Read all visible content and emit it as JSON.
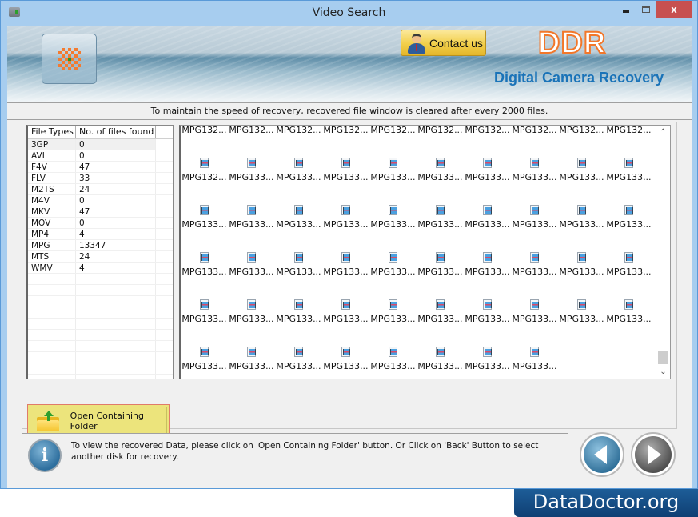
{
  "window": {
    "title": "Video Search",
    "controls": {
      "minimize": "-",
      "maximize": "□",
      "close": "x"
    }
  },
  "banner": {
    "logo_icon": "ddr-dots-logo-icon",
    "contact_button": {
      "label": "Contact us",
      "icon": "support-person-icon"
    },
    "brand_logo": "DDR",
    "product_name": "Digital Camera Recovery"
  },
  "notice": "To maintain the speed of recovery, recovered file window is cleared after every 2000 files.",
  "file_types_table": {
    "columns": [
      "File Types",
      "No. of files found"
    ],
    "rows": [
      {
        "type": "3GP",
        "count": "0"
      },
      {
        "type": "AVI",
        "count": "0"
      },
      {
        "type": "F4V",
        "count": "47"
      },
      {
        "type": "FLV",
        "count": "33"
      },
      {
        "type": "M2TS",
        "count": "24"
      },
      {
        "type": "M4V",
        "count": "0"
      },
      {
        "type": "MKV",
        "count": "47"
      },
      {
        "type": "MOV",
        "count": "0"
      },
      {
        "type": "MP4",
        "count": "4"
      },
      {
        "type": "MPG",
        "count": "13347"
      },
      {
        "type": "MTS",
        "count": "24"
      },
      {
        "type": "WMV",
        "count": "4"
      }
    ],
    "empty_rows": 10
  },
  "open_folder_button": {
    "label": "Open Containing Folder",
    "icon": "folder-up-arrow-icon"
  },
  "recovered_files": {
    "icon": "video-file-icon",
    "items": [
      "MPG132...",
      "MPG132...",
      "MPG132...",
      "MPG132...",
      "MPG132...",
      "MPG132...",
      "MPG132...",
      "MPG132...",
      "MPG132...",
      "MPG132...",
      "MPG132...",
      "MPG133...",
      "MPG133...",
      "MPG133...",
      "MPG133...",
      "MPG133...",
      "MPG133...",
      "MPG133...",
      "MPG133...",
      "MPG133...",
      "MPG133...",
      "MPG133...",
      "MPG133...",
      "MPG133...",
      "MPG133...",
      "MPG133...",
      "MPG133...",
      "MPG133...",
      "MPG133...",
      "MPG133...",
      "MPG133...",
      "MPG133...",
      "MPG133...",
      "MPG133...",
      "MPG133...",
      "MPG133...",
      "MPG133...",
      "MPG133...",
      "MPG133...",
      "MPG133...",
      "MPG133...",
      "MPG133...",
      "MPG133...",
      "MPG133...",
      "MPG133...",
      "MPG133...",
      "MPG133...",
      "MPG133...",
      "MPG133...",
      "MPG133...",
      "MPG133...",
      "MPG133...",
      "MPG133...",
      "MPG133...",
      "MPG133...",
      "MPG133...",
      "MPG133...",
      "MPG133..."
    ],
    "scroll_position_fraction": 0.95
  },
  "info": {
    "icon": "info-icon",
    "text": "To view the recovered Data, please click on 'Open Containing Folder' button. Or Click on 'Back' Button to select another disk for recovery."
  },
  "navigation": {
    "back": "back-arrow-icon",
    "next": "next-arrow-icon"
  },
  "footer_brand": "DataDoctor.org",
  "colors": {
    "accent": "#1a73b8",
    "ddr_orange": "#f2772a",
    "close_red": "#c75050",
    "button_yellow": "#ece47c"
  }
}
